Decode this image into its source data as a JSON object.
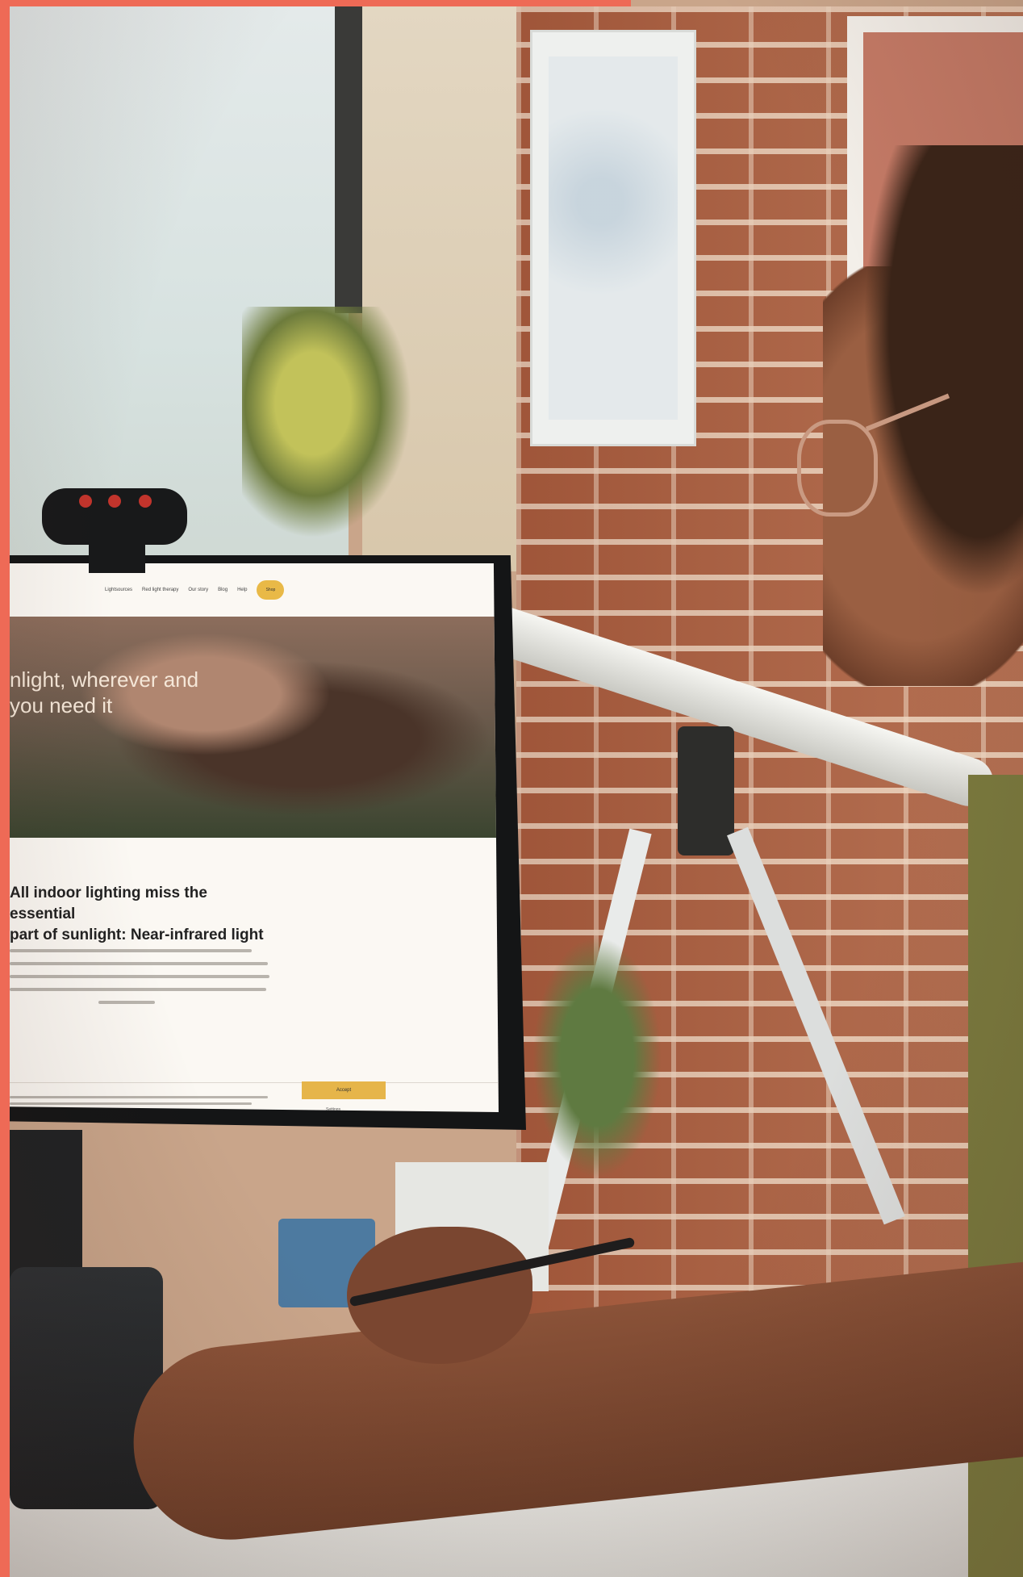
{
  "website": {
    "nav": {
      "links": [
        "Lightsources",
        "Red light therapy",
        "Our story",
        "Blog",
        "Help"
      ],
      "cta_label": "Shop"
    },
    "hero": {
      "title_line1": "nlight, wherever and",
      "title_line2": "you need it",
      "subtitle": ""
    },
    "section": {
      "heading_line1": "All indoor lighting miss the essential",
      "heading_line2": "part of sunlight: Near-infrared light",
      "body": ""
    },
    "cookie_banner": {
      "text": "",
      "accept_label": "Accept",
      "settings_label": "Settings"
    }
  },
  "colors": {
    "frame_accent": "#ee6a56",
    "cta_yellow": "#e9b947",
    "webcam_leds": "#c2342c"
  }
}
